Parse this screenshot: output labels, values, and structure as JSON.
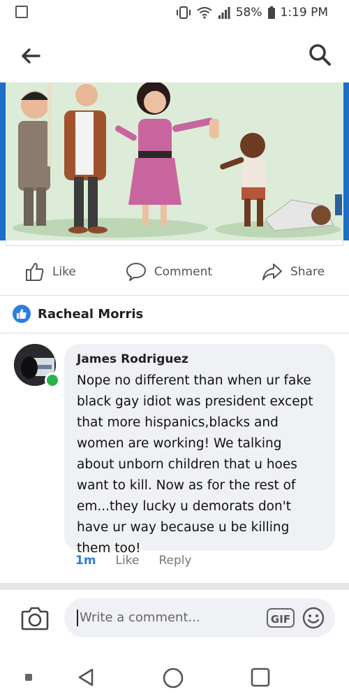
{
  "status": {
    "battery_percent": "58%",
    "time": "1:19 PM"
  },
  "actions": {
    "like": "Like",
    "comment": "Comment",
    "share": "Share"
  },
  "reactor": {
    "name": "Racheal Morris"
  },
  "comment": {
    "author": "James Rodriguez",
    "text": "Nope no different than when ur fake black gay idiot was president except that more hispanics,blacks and women are working! We talking about unborn children that u hoes want to kill. Now as for the rest of em...they lucky u demorats don't have ur way because u be killing them too!",
    "time": "1m",
    "like": "Like",
    "reply": "Reply"
  },
  "composer": {
    "placeholder": "Write a comment...",
    "gif": "GIF"
  },
  "colors": {
    "accent": "#2d7de0",
    "online": "#2ab34b",
    "bubble": "#f0f1f4"
  }
}
